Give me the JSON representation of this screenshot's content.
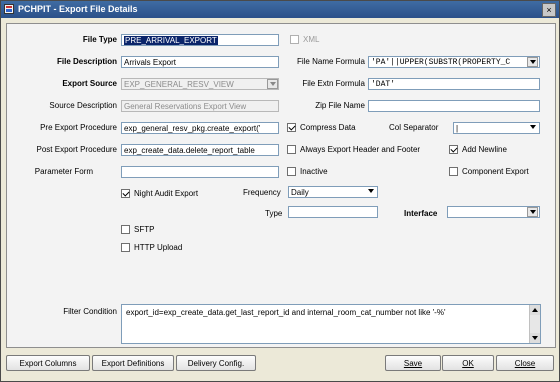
{
  "window": {
    "title": "PCHPIT - Export File Details",
    "icon": "app-icon",
    "close": "×"
  },
  "form": {
    "file_type": {
      "label": "File Type",
      "value": "PRE_ARRIVAL_EXPORT"
    },
    "xml": {
      "label": "XML",
      "checked": false
    },
    "file_description": {
      "label": "File Description",
      "value": "Arrivals Export"
    },
    "file_name_formula": {
      "label": "File Name Formula",
      "value": "'PA'||UPPER(SUBSTR(PROPERTY_C"
    },
    "export_source": {
      "label": "Export Source",
      "value": "EXP_GENERAL_RESV_VIEW"
    },
    "file_extn_formula": {
      "label": "File Extn Formula",
      "value": "'DAT'"
    },
    "source_description": {
      "label": "Source Description",
      "value": "General Reservations Export View"
    },
    "zip_file_name": {
      "label": "Zip File Name",
      "value": ""
    },
    "pre_export_procedure": {
      "label": "Pre Export Procedure",
      "value": "exp_general_resv_pkg.create_export('"
    },
    "compress_data": {
      "label": "Compress Data",
      "checked": true
    },
    "col_separator": {
      "label": "Col Separator",
      "value": "|"
    },
    "post_export_procedure": {
      "label": "Post Export Procedure",
      "value": "exp_create_data.delete_report_table"
    },
    "always_export_header_footer": {
      "label": "Always Export Header and Footer",
      "checked": false
    },
    "add_newline": {
      "label": "Add Newline",
      "checked": true
    },
    "parameter_form": {
      "label": "Parameter Form",
      "value": ""
    },
    "inactive": {
      "label": "Inactive",
      "checked": false
    },
    "component_export": {
      "label": "Component Export",
      "checked": false
    },
    "night_audit_export": {
      "label": "Night Audit Export",
      "checked": true
    },
    "frequency": {
      "label": "Frequency",
      "value": "Daily"
    },
    "type": {
      "label": "Type",
      "value": ""
    },
    "interface": {
      "label": "Interface",
      "value": ""
    },
    "sftp": {
      "label": "SFTP",
      "checked": false
    },
    "http_upload": {
      "label": "HTTP Upload",
      "checked": false
    },
    "filter_condition": {
      "label": "Filter Condition",
      "value": "export_id=exp_create_data.get_last_report_id and internal_room_cat_number not like '-%'"
    }
  },
  "buttons": {
    "export_columns": "Export Columns",
    "export_definitions": "Export Definitions",
    "delivery_config": "Delivery Config.",
    "save": "Save",
    "ok": "OK",
    "close": "Close"
  }
}
